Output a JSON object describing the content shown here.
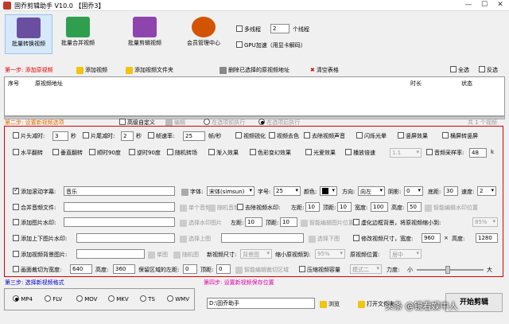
{
  "window": {
    "title": "固乔剪辑助手 V10.0   【固乔3】",
    "min": "—",
    "max": "☐",
    "close": "✕"
  },
  "toolbar": {
    "items": [
      {
        "label": "批量转换视频",
        "color": "#6a4fa0"
      },
      {
        "label": "批量合并视频",
        "color": "#2f9e4f"
      },
      {
        "label": "批量剪辑视频",
        "color": "#8e44ad"
      },
      {
        "label": "会员管理中心",
        "color": "#d35400"
      }
    ],
    "multithread": "多线程",
    "thread_count": "2",
    "thread_unit": "个线程",
    "gpu": "GPU加速（用显卡解码）"
  },
  "step1": {
    "label": "第一步: 添加原视频",
    "add_video": "添加视频",
    "add_folder": "添加视频文件夹",
    "delete_selected": "删除已选择的原视频地址",
    "clear": "清空表格",
    "select_all": "全选",
    "invert": "反选"
  },
  "table": {
    "col_no": "序号",
    "col_path": "原视频地址",
    "col_len": "时长",
    "col_status": "状态"
  },
  "step2": {
    "label": "第二步: 设置新视频选项",
    "advanced": "高级自定义",
    "edit": "编辑",
    "before_opt": "在选项前执行",
    "after_opt": "在选项后执行",
    "count": "共 1 个视频"
  },
  "opts": {
    "cut_head": "片头减时:",
    "cut_head_v": "3",
    "sec1": "秒",
    "cut_tail": "片尾减时:",
    "cut_tail_v": "2",
    "sec2": "秒",
    "fps": "帧速率:",
    "fps_v": "25",
    "fps_unit": "帧/秒",
    "sharpen": "视频锐化",
    "decolor": "视频去色",
    "remove_audio": "去除视频声音",
    "flash": "闪烁光晕",
    "vert_blur": "竖屏效果",
    "horiz_blur": "横屏转竖屏",
    "hflip": "水平翻转",
    "vflip": "垂直翻转",
    "rot90": "顺时90度",
    "rot90r": "逆时90度",
    "random_trans": "随机转场",
    "fade": "渐入效果",
    "color_shift": "色彩变幻效果",
    "light": "光爱效果",
    "speed": "播放倍速",
    "speed_v": "1.1",
    "sample": "音频采样率:",
    "sample_v": "48",
    "sample_unit": "k",
    "subtitle": "添加滚动字幕:",
    "subtitle_v": "音乐",
    "font": "字体:",
    "font_v": "宋体(simsun)",
    "size": "字号:",
    "size_v": "25",
    "color": "颜色:",
    "dir": "方向:",
    "dir_v": "向左",
    "shadow": "阴影:",
    "shadow_v": "0",
    "bottom": "底距:",
    "bottom_v": "30",
    "spd": "速度:",
    "spd_v": "2",
    "merge_audio": "合并音频文件:",
    "single_audio": "单个音频",
    "random_audio": "随机音频",
    "remove_wm": "去除视频水印:",
    "left": "左距:",
    "left_v": "10",
    "top": "顶距:",
    "top_v": "10",
    "width": "宽度:",
    "width_v": "100",
    "height": "高度:",
    "height_v": "50",
    "smart_wm": "智能编辑水印位置",
    "add_wm": "添加图片水印:",
    "choose_wm": "选择水印图片",
    "left2": "左距:",
    "left2_v": "10",
    "top2": "顶距:",
    "top2_v": "10",
    "smart_img": "智能编辑图片位置",
    "virtual_border": "虚化边框背景，将原视频缩小到:",
    "shrink_v": "85%",
    "add_topbot": "添加上下图片水印:",
    "choose_top": "选择上图",
    "choose_bot": "选择下图",
    "resize": "修改视频尺寸，宽度:",
    "resize_w": "960",
    "times": "×",
    "resize_h_lbl": "高度:",
    "resize_h": "1280",
    "add_bg": "添加视频背景图片:",
    "single_img": "单图",
    "random_img": "随机图",
    "new_size": "新视频尺寸:",
    "new_size_v": "背景图",
    "shrink": "缩小原视频到:",
    "shrink2_v": "95%",
    "pos": "原视频位置:",
    "pos_v": "居中",
    "crop": "画面裁切为宽度:",
    "crop_w": "640",
    "crop_h_lbl": "高度:",
    "crop_h": "360",
    "keep_left": "保留区域的左距:",
    "keep_left_v": "0",
    "keep_top": "顶距:",
    "keep_top_v": "0",
    "smart_crop": "智能编辑裁切区域",
    "compress": "压缩视频容量",
    "mode_v": "模式二",
    "strength": "力度:",
    "small": "小",
    "big": "大"
  },
  "step3": {
    "label": "第三步: 选择新视频格式",
    "formats": [
      "MP4",
      "FLV",
      "MOV",
      "MKV",
      "TS",
      "WMV"
    ],
    "selected": "MP4"
  },
  "step4": {
    "label": "第四步: 设置新视频保存位置",
    "path": "D:\\固乔助手",
    "browse": "浏览",
    "open": "打开文件夹",
    "start": "开始剪辑"
  },
  "watermark": "头条 @镜看娱中人"
}
